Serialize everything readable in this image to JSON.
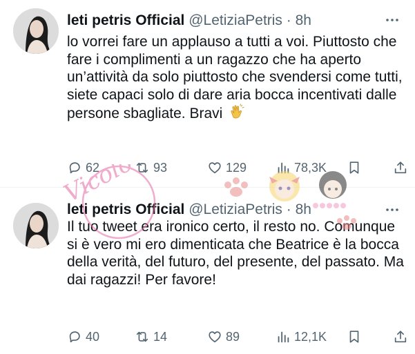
{
  "tweets": [
    {
      "name": "leti petris Official",
      "handle": "@LetiziaPetris",
      "dot": "·",
      "time": "8h",
      "text": "lo vorrei fare un applauso a tutti a voi. Piuttosto che fare i complimenti a un ragazzo che ha aperto un’attività da solo piuttosto che svendersi come tutti, siete capaci solo di dare aria bocca incentivati dalle persone sbagliate. Bravi",
      "emoji": "clapping-hands",
      "replies": "62",
      "retweets": "93",
      "likes": "129",
      "views": "78,3K"
    },
    {
      "name": "leti petris Official",
      "handle": "@LetiziaPetris",
      "dot": "·",
      "time": "8h",
      "text": "Il tuo tweet era ironico certo, il resto no. Comunque si è vero mi ero dimenticata che Beatrice è la bocca della verità, del futuro, del presente, del passato. Ma dai ragazzi! Per favore!",
      "replies": "40",
      "retweets": "14",
      "likes": "89",
      "views": "12,1K"
    }
  ],
  "watermark": {
    "text": "Vicolo"
  },
  "icons": [
    "reply-icon",
    "retweet-icon",
    "like-icon",
    "views-icon",
    "bookmark-icon",
    "share-icon",
    "more-icon"
  ],
  "colors": {
    "text": "#0f1419",
    "secondary": "#536471",
    "divider": "#eff3f4",
    "watermark": "#e56aa3"
  }
}
